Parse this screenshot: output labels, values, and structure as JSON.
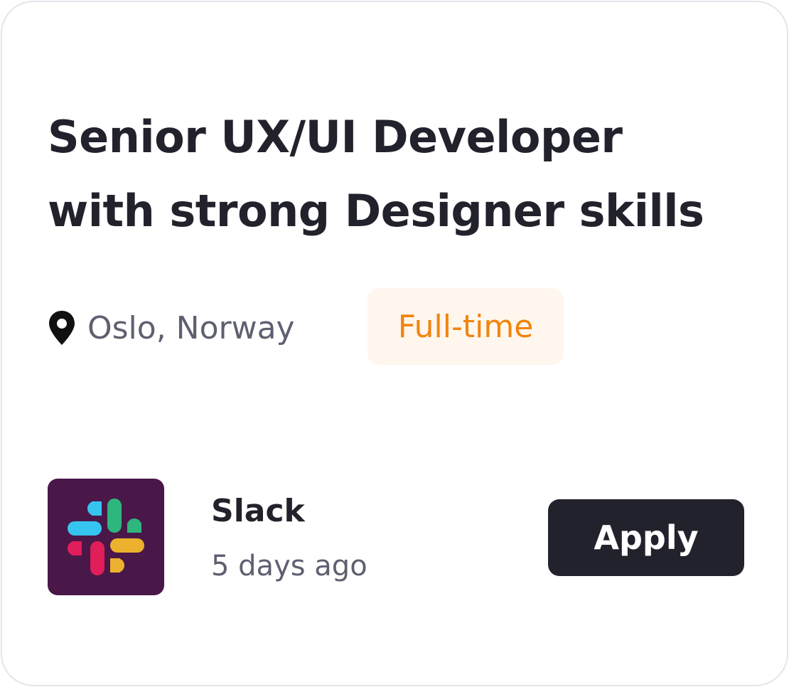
{
  "job": {
    "title_line1": "Senior UX/UI Developer",
    "title_line2": "with strong Designer skills",
    "location": "Oslo, Norway",
    "employment_type": "Full-time"
  },
  "company": {
    "name": "Slack",
    "posted": "5 days ago",
    "logo_icon": "slack-logo-icon"
  },
  "actions": {
    "apply_label": "Apply"
  },
  "colors": {
    "title_text": "#22222c",
    "muted_text": "#5e6070",
    "badge_bg": "#fff6ee",
    "badge_text": "#f2840c",
    "button_bg": "#22222c",
    "button_text": "#ffffff",
    "logo_bg": "#4a1749",
    "card_border": "#e4e4ec"
  }
}
